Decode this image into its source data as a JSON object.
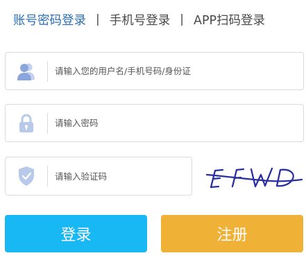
{
  "tabs": [
    {
      "label": "账号密码登录",
      "active": true
    },
    {
      "label": "手机号登录",
      "active": false
    },
    {
      "label": "APP扫码登录",
      "active": false
    }
  ],
  "tab_separator": "|",
  "fields": {
    "username": {
      "placeholder": "请输入您的用户名/手机号码/身份证",
      "value": "",
      "icon": "user-icon"
    },
    "password": {
      "placeholder": "请输入密码",
      "value": "",
      "icon": "lock-icon"
    },
    "captcha": {
      "placeholder": "请输入验证码",
      "value": "",
      "icon": "shield-check-icon"
    }
  },
  "captcha_image": {
    "text": "EFWD"
  },
  "buttons": {
    "login": "登录",
    "register": "注册"
  },
  "colors": {
    "active_tab": "#2d6fb7",
    "icon": "#9ab3e0",
    "login_button": "#18b8f5",
    "register_button": "#efb136",
    "captcha_ink": "#2a2fa0"
  }
}
